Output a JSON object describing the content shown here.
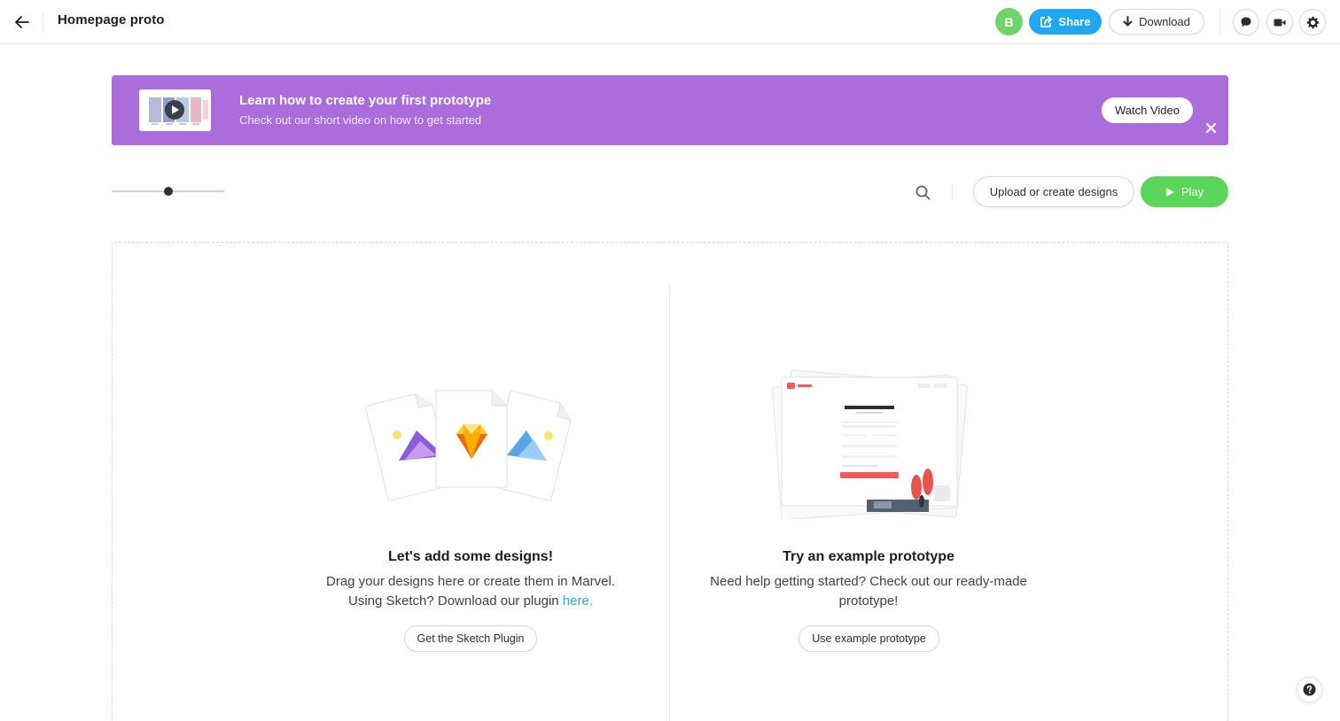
{
  "header": {
    "title": "Homepage proto",
    "avatar_initial": "B",
    "share_label": "Share",
    "download_label": "Download"
  },
  "banner": {
    "title": "Learn how to create your first prototype",
    "subtitle": "Check out our short video on how to get started",
    "watch_label": "Watch Video"
  },
  "toolbar": {
    "zoom_level": 0.5,
    "upload_label": "Upload or create designs",
    "play_label": "Play"
  },
  "empty_left": {
    "title": "Let's add some designs!",
    "line1": "Drag your designs here or create them in Marvel.",
    "line2_prefix": "Using Sketch? Download our plugin ",
    "line2_link": "here.",
    "button_label": "Get the Sketch Plugin"
  },
  "empty_right": {
    "title": "Try an example prototype",
    "text": "Need help getting started? Check out our ready-made prototype!",
    "button_label": "Use example prototype"
  },
  "colors": {
    "accent_blue": "#1fa8f0",
    "banner_purple": "#ab6ddc",
    "play_green": "#5bd55a",
    "avatar_green": "#6fd469"
  }
}
